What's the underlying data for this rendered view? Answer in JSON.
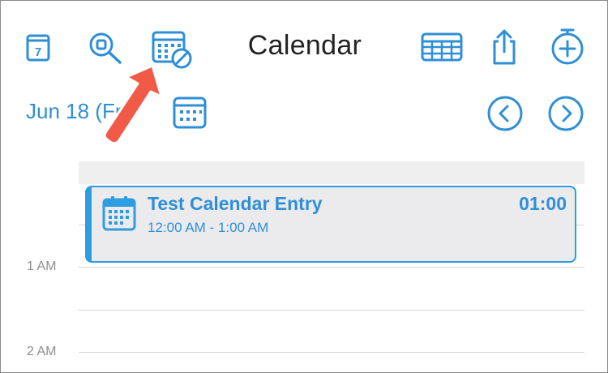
{
  "header": {
    "title": "Calendar"
  },
  "toolbar": {
    "today_day": "7",
    "icons": [
      "calendar-today-icon",
      "search-icon",
      "calendar-block-icon",
      "week-grid-icon",
      "share-icon",
      "add-timer-icon"
    ]
  },
  "nav": {
    "date_label": "Jun 18 (Fri)"
  },
  "day_view": {
    "hour_labels": [
      "1 AM",
      "2 AM"
    ],
    "event": {
      "title": "Test Calendar Entry",
      "time_range": "12:00 AM - 1:00 AM",
      "duration": "01:00"
    }
  },
  "colors": {
    "accent": "#2f8fd6",
    "event_bg": "#ebebed",
    "arrow": "#f05a47"
  }
}
